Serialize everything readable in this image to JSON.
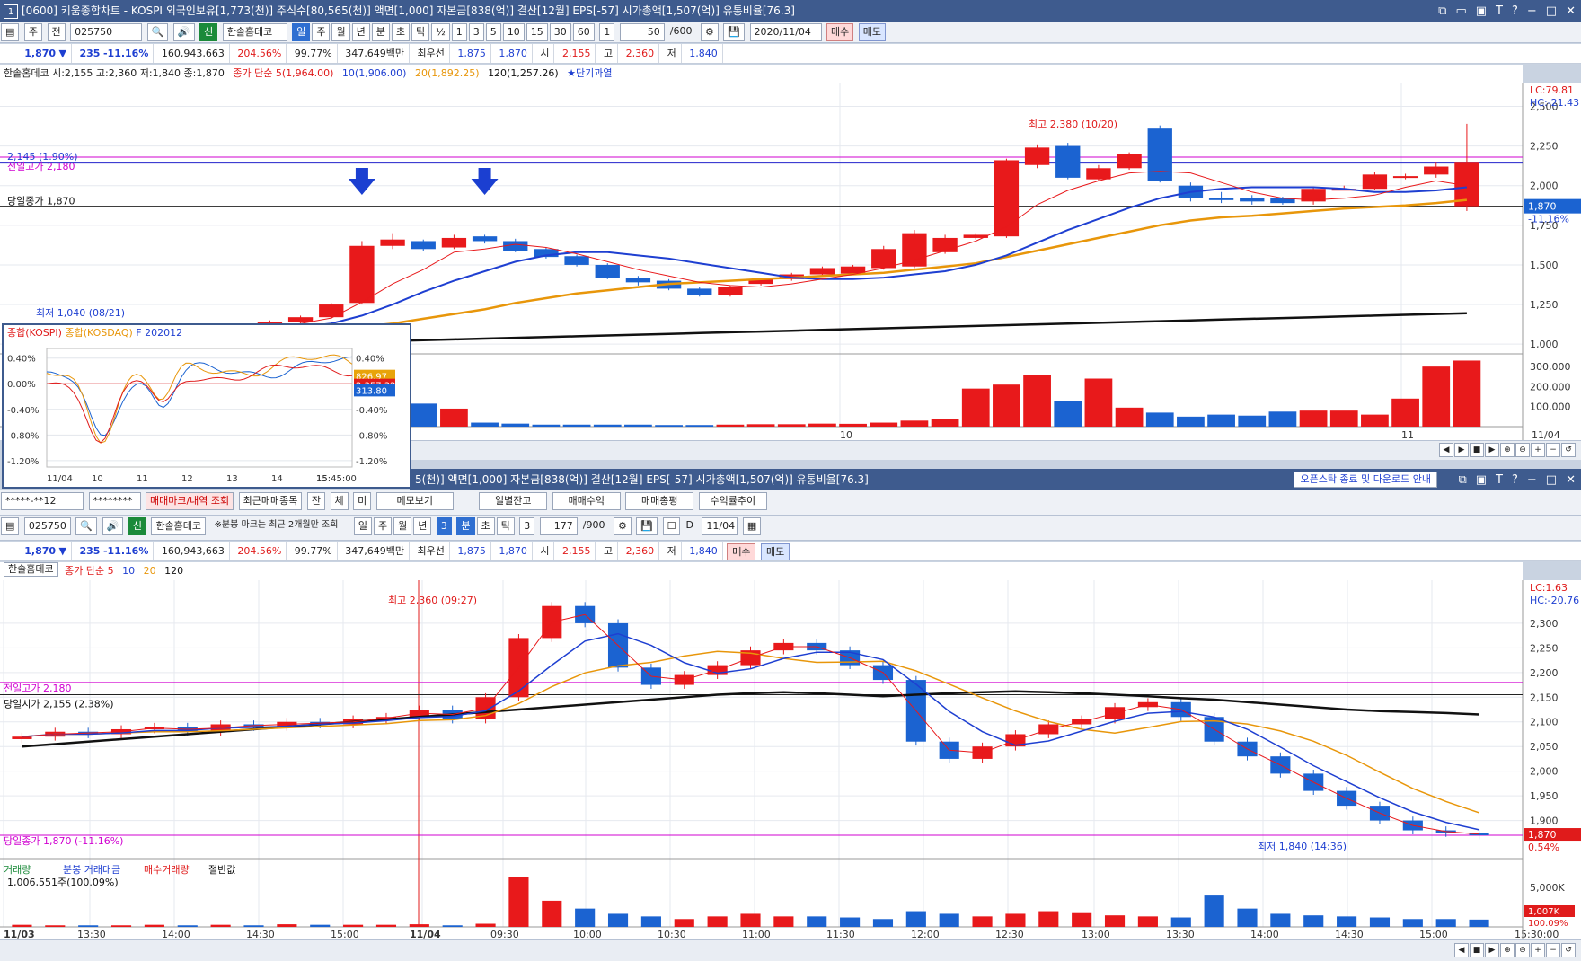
{
  "window1": {
    "title_num": "1",
    "title": "[0600] 키움종합차트 - KOSPI 외국인보유[1,773(천)] 주식수[80,565(천)] 액면[1,000] 자본금[838(억)] 결산[12월] EPS[-57] 시가총액[1,507(억)] 유통비율[76.3]",
    "toolbar": {
      "type": "주",
      "range": "전",
      "code": "025750",
      "badge": "신",
      "name": "한솔홈데코",
      "period_tabs": [
        "일",
        "주",
        "월",
        "년",
        "분",
        "초",
        "틱",
        "½",
        "1",
        "3",
        "5",
        "10",
        "15",
        "30",
        "60"
      ],
      "selected_period": "일",
      "interval": "1",
      "count": "50",
      "count_max": "/600",
      "date": "2020/11/04",
      "buy": "매수",
      "sell": "매도"
    },
    "quote": {
      "price": "1,870",
      "arrow": "▼",
      "change": "235",
      "change_pct": "-11.16%",
      "volume": "160,943,663",
      "vol_ratio": "204.56%",
      "strength": "99.77%",
      "amount": "347,649백만",
      "best_label": "최우선",
      "ask": "1,875",
      "bid": "1,870",
      "open_label": "시",
      "open": "2,155",
      "high_label": "고",
      "high": "2,360",
      "low_label": "저",
      "low": "1,840"
    },
    "legend": {
      "stock": "한솔홈데코 시:2,155 고:2,360 저:1,840 종:1,870",
      "ma_title": "종가 단순 5(1,964.00)",
      "ma10": "10(1,906.00)",
      "ma20": "20(1,892.25)",
      "ma120": "120(1,257.26)",
      "signal": "★단기과열"
    },
    "annotations": {
      "line1": "2,145 (1.90%)",
      "prev_high": "전일고가 2,180",
      "close": "당일종가 1,870",
      "max": "최고 2,380 (10/20)",
      "min": "최저 1,040 (08/21)"
    },
    "right_axis": {
      "lc": "LC:79.81",
      "hc": "HC:-21.43",
      "ticks": [
        "2,500",
        "2,250",
        "2,000",
        "1,750",
        "1,500",
        "1,250",
        "1,000"
      ],
      "price_tag": "1,870",
      "pct_tag": "-11.16%",
      "vol_ticks": [
        "300,000",
        "200,000",
        "100,000"
      ]
    },
    "date_labels": [
      "10",
      "11",
      "11/04"
    ]
  },
  "mini_chart": {
    "legend": [
      "종합(KOSPI)",
      "종합(KOSDAQ)",
      "F 202012"
    ],
    "left_ticks": [
      "0.40%",
      "0.00%",
      "-0.40%",
      "-0.80%",
      "-1.20%"
    ],
    "right_ticks": [
      "0.40%",
      "-0.40%",
      "-0.80%",
      "-1.20%"
    ],
    "tags": [
      "826.97",
      "2,357.32",
      "313.80"
    ],
    "x_labels": [
      "11/04",
      "10",
      "11",
      "12",
      "13",
      "14",
      "15",
      "15:45:00"
    ]
  },
  "window2": {
    "title": "5(천)] 액면[1,000] 자본금[838(억)] 결산[12월] EPS[-57] 시가총액[1,507(억)] 유통비율[76.3]",
    "notice": "오픈스탁 종료 및 다운로드 안내",
    "account": "*****-**12",
    "password": "********",
    "buttons": [
      "매매마크/내역 조회",
      "최근매매종목",
      "잔",
      "체",
      "미",
      "메모보기",
      "일별잔고",
      "매매수익",
      "매매총평",
      "수익률추이"
    ],
    "toolbar": {
      "code": "025750",
      "badge": "신",
      "name": "한솔홈데코",
      "note": "※분봉 마크는 최근 2개월만 조회",
      "period_tabs": [
        "일",
        "주",
        "월",
        "년",
        "분",
        "초",
        "틱"
      ],
      "selected_period": "분",
      "day_count": "3",
      "interval": "3",
      "count": "177",
      "count_max": "/900",
      "d_label": "D",
      "date": "11/04"
    },
    "quote": {
      "price": "1,870",
      "arrow": "▼",
      "change": "235",
      "change_pct": "-11.16%",
      "volume": "160,943,663",
      "vol_ratio": "204.56%",
      "strength": "99.77%",
      "amount": "347,649백만",
      "best_label": "최우선",
      "ask": "1,875",
      "bid": "1,870",
      "open_label": "시",
      "open": "2,155",
      "high_label": "고",
      "high": "2,360",
      "low_label": "저",
      "low": "1,840",
      "buy": "매수",
      "sell": "매도"
    },
    "legend": {
      "stock": "한솔홈데코",
      "ma_title": "종가 단순 5",
      "ma10": "10",
      "ma20": "20",
      "ma120": "120"
    },
    "annotations": {
      "max": "최고 2,360 (09:27)",
      "prev_high": "전일고가 2,180",
      "open": "당일시가 2,155 (2.38%)",
      "close": "당일종가 1,870 (-11.16%)",
      "min": "최저 1,840 (14:36)"
    },
    "right_axis": {
      "lc": "LC:1.63",
      "hc": "HC:-20.76",
      "ticks": [
        "2,300",
        "2,250",
        "2,200",
        "2,150",
        "2,100",
        "2,050",
        "2,000",
        "1,950",
        "1,900"
      ],
      "price_tag": "1,870",
      "pct_tag": "0.54%",
      "vol_ticks": [
        "5,000K"
      ],
      "vol_tag": "1,007K",
      "vol_pct": "100.09%"
    },
    "vol_legend": {
      "a": "거래량",
      "b": "분봉 거래대금",
      "c": "매수거래량",
      "d": "절반값",
      "value": "1,006,551주(100.09%)"
    },
    "x_labels": [
      "11/03",
      "13:30",
      "14:00",
      "14:30",
      "15:00",
      "11/04",
      "09:30",
      "10:00",
      "10:30",
      "11:00",
      "11:30",
      "12:00",
      "12:30",
      "13:00",
      "13:30",
      "14:00",
      "14:30",
      "15:00",
      "15:30:00"
    ]
  },
  "colors": {
    "up": "#e8191b",
    "down": "#1b63d1",
    "ma5": "#e8191b",
    "ma10": "#1e3fd1",
    "ma20": "#e8960a",
    "ma120": "#111111",
    "title_bar": "#3e5b8e"
  },
  "chart_data": [
    {
      "type": "candlestick",
      "title": "한솔홈데코 일봉",
      "ylim": [
        950,
        2650
      ],
      "x": [
        "",
        "",
        "",
        "",
        "",
        "",
        "",
        "",
        "",
        "",
        "",
        "",
        "",
        "",
        "",
        "",
        "",
        "",
        "",
        "",
        "",
        "",
        "",
        "",
        "",
        "",
        "",
        "",
        "",
        "",
        "",
        "",
        "",
        "",
        "",
        "",
        "",
        "",
        "",
        "",
        "",
        "",
        "",
        "",
        "",
        "",
        "",
        "",
        "",
        "11/04"
      ],
      "open": [
        1060,
        1110,
        1120,
        1100,
        1080,
        1095,
        1115,
        1105,
        1110,
        1140,
        1170,
        1260,
        1620,
        1650,
        1610,
        1680,
        1650,
        1600,
        1555,
        1500,
        1420,
        1400,
        1350,
        1310,
        1380,
        1410,
        1440,
        1445,
        1480,
        1490,
        1580,
        1670,
        1680,
        2130,
        2250,
        2040,
        2110,
        2360,
        2000,
        1920,
        1920,
        1920,
        1900,
        1980,
        1980,
        2060,
        2070,
        1870
      ],
      "close": [
        1080,
        1120,
        1100,
        1070,
        1085,
        1110,
        1105,
        1115,
        1140,
        1170,
        1250,
        1620,
        1660,
        1600,
        1670,
        1650,
        1590,
        1550,
        1500,
        1420,
        1390,
        1350,
        1310,
        1360,
        1410,
        1440,
        1480,
        1490,
        1600,
        1700,
        1670,
        1690,
        2160,
        2240,
        2050,
        2110,
        2200,
        2030,
        1920,
        1910,
        1900,
        1890,
        1980,
        1980,
        2070,
        2060,
        2120,
        2150
      ],
      "high": [
        1090,
        1130,
        1130,
        1110,
        1095,
        1120,
        1125,
        1125,
        1150,
        1180,
        1260,
        1650,
        1700,
        1660,
        1690,
        1690,
        1665,
        1610,
        1565,
        1510,
        1430,
        1410,
        1360,
        1370,
        1420,
        1450,
        1490,
        1500,
        1620,
        1720,
        1690,
        1700,
        2170,
        2260,
        2270,
        2130,
        2210,
        2380,
        2020,
        1960,
        1940,
        1930,
        1995,
        2000,
        2085,
        2075,
        2150,
        2390
      ],
      "low": [
        1040,
        1100,
        1090,
        1060,
        1070,
        1085,
        1095,
        1095,
        1105,
        1130,
        1160,
        1250,
        1600,
        1590,
        1600,
        1635,
        1580,
        1540,
        1490,
        1410,
        1370,
        1340,
        1300,
        1300,
        1370,
        1400,
        1430,
        1440,
        1470,
        1480,
        1570,
        1660,
        1670,
        2110,
        2040,
        2030,
        2100,
        2020,
        1900,
        1890,
        1880,
        1880,
        1880,
        1970,
        1970,
        2040,
        2050,
        1840
      ],
      "volume": [
        5,
        6,
        4,
        5,
        5,
        6,
        5,
        4,
        5,
        6,
        9,
        160,
        240,
        115,
        90,
        20,
        15,
        10,
        10,
        10,
        10,
        8,
        8,
        10,
        12,
        12,
        15,
        14,
        20,
        30,
        40,
        190,
        210,
        260,
        130,
        240,
        95,
        70,
        50,
        60,
        55,
        75,
        80,
        80,
        60,
        140,
        300,
        330
      ],
      "ma5": [
        1070,
        1085,
        1095,
        1095,
        1090,
        1092,
        1100,
        1105,
        1110,
        1130,
        1165,
        1265,
        1380,
        1470,
        1580,
        1600,
        1630,
        1610,
        1570,
        1520,
        1470,
        1430,
        1390,
        1370,
        1360,
        1380,
        1410,
        1440,
        1480,
        1530,
        1590,
        1650,
        1740,
        1880,
        1970,
        2030,
        2080,
        2090,
        2080,
        2020,
        1960,
        1920,
        1910,
        1920,
        1940,
        1990,
        2030,
        2000
      ],
      "ma10": [
        1060,
        1065,
        1070,
        1075,
        1080,
        1085,
        1090,
        1095,
        1100,
        1110,
        1130,
        1180,
        1250,
        1330,
        1400,
        1460,
        1520,
        1560,
        1580,
        1580,
        1560,
        1540,
        1510,
        1480,
        1450,
        1420,
        1410,
        1410,
        1420,
        1440,
        1460,
        1500,
        1560,
        1640,
        1720,
        1790,
        1860,
        1920,
        1960,
        1980,
        1990,
        1990,
        1990,
        1980,
        1960,
        1960,
        1970,
        1990
      ],
      "ma20": [
        1050,
        1052,
        1055,
        1058,
        1062,
        1066,
        1070,
        1075,
        1080,
        1085,
        1095,
        1110,
        1130,
        1160,
        1190,
        1220,
        1260,
        1290,
        1320,
        1340,
        1360,
        1380,
        1390,
        1400,
        1410,
        1420,
        1430,
        1440,
        1450,
        1470,
        1490,
        1510,
        1550,
        1590,
        1630,
        1670,
        1710,
        1750,
        1780,
        1800,
        1810,
        1825,
        1840,
        1855,
        1865,
        1875,
        1890,
        1910
      ],
      "ma120": [
        960,
        965,
        970,
        975,
        980,
        985,
        990,
        995,
        1000,
        1005,
        1010,
        1015,
        1020,
        1025,
        1030,
        1035,
        1040,
        1045,
        1050,
        1055,
        1060,
        1065,
        1070,
        1075,
        1080,
        1085,
        1090,
        1095,
        1100,
        1105,
        1110,
        1115,
        1120,
        1125,
        1130,
        1135,
        1140,
        1145,
        1150,
        1155,
        1160,
        1165,
        1170,
        1175,
        1180,
        1185,
        1190,
        1195
      ]
    },
    {
      "type": "candlestick",
      "title": "한솔홈데코 3분봉",
      "ylim": [
        1830,
        2380
      ],
      "x": [
        "11/03",
        "13:30",
        "14:00",
        "14:30",
        "15:00",
        "11/04",
        "09:30",
        "10:00",
        "10:30",
        "11:00",
        "11:30",
        "12:00",
        "12:30",
        "13:00",
        "13:30",
        "14:00",
        "14:30",
        "15:00"
      ],
      "close": [
        2070,
        2080,
        2075,
        2085,
        2090,
        2080,
        2095,
        2090,
        2100,
        2095,
        2105,
        2110,
        2125,
        2105,
        2150,
        2270,
        2335,
        2300,
        2210,
        2175,
        2195,
        2215,
        2245,
        2260,
        2245,
        2215,
        2185,
        2060,
        2025,
        2050,
        2075,
        2095,
        2105,
        2130,
        2140,
        2110,
        2060,
        2030,
        1995,
        1960,
        1930,
        1900,
        1880,
        1875,
        1870
      ],
      "ma120": [
        2050,
        2055,
        2060,
        2065,
        2070,
        2075,
        2080,
        2085,
        2090,
        2095,
        2100,
        2105,
        2110,
        2115,
        2120,
        2125,
        2130,
        2135,
        2140,
        2145,
        2150,
        2155,
        2158,
        2160,
        2158,
        2155,
        2152,
        2155,
        2158,
        2160,
        2162,
        2160,
        2158,
        2155,
        2152,
        2148,
        2145,
        2140,
        2135,
        2130,
        2125,
        2122,
        2120,
        2118,
        2115
      ],
      "volume": [
        4,
        3,
        3,
        3,
        4,
        3,
        4,
        3,
        5,
        4,
        4,
        4,
        5,
        3,
        6,
        95,
        50,
        35,
        25,
        20,
        15,
        20,
        25,
        20,
        20,
        18,
        15,
        30,
        25,
        20,
        25,
        30,
        28,
        22,
        20,
        18,
        60,
        35,
        25,
        22,
        20,
        18,
        15,
        15,
        14
      ]
    }
  ]
}
